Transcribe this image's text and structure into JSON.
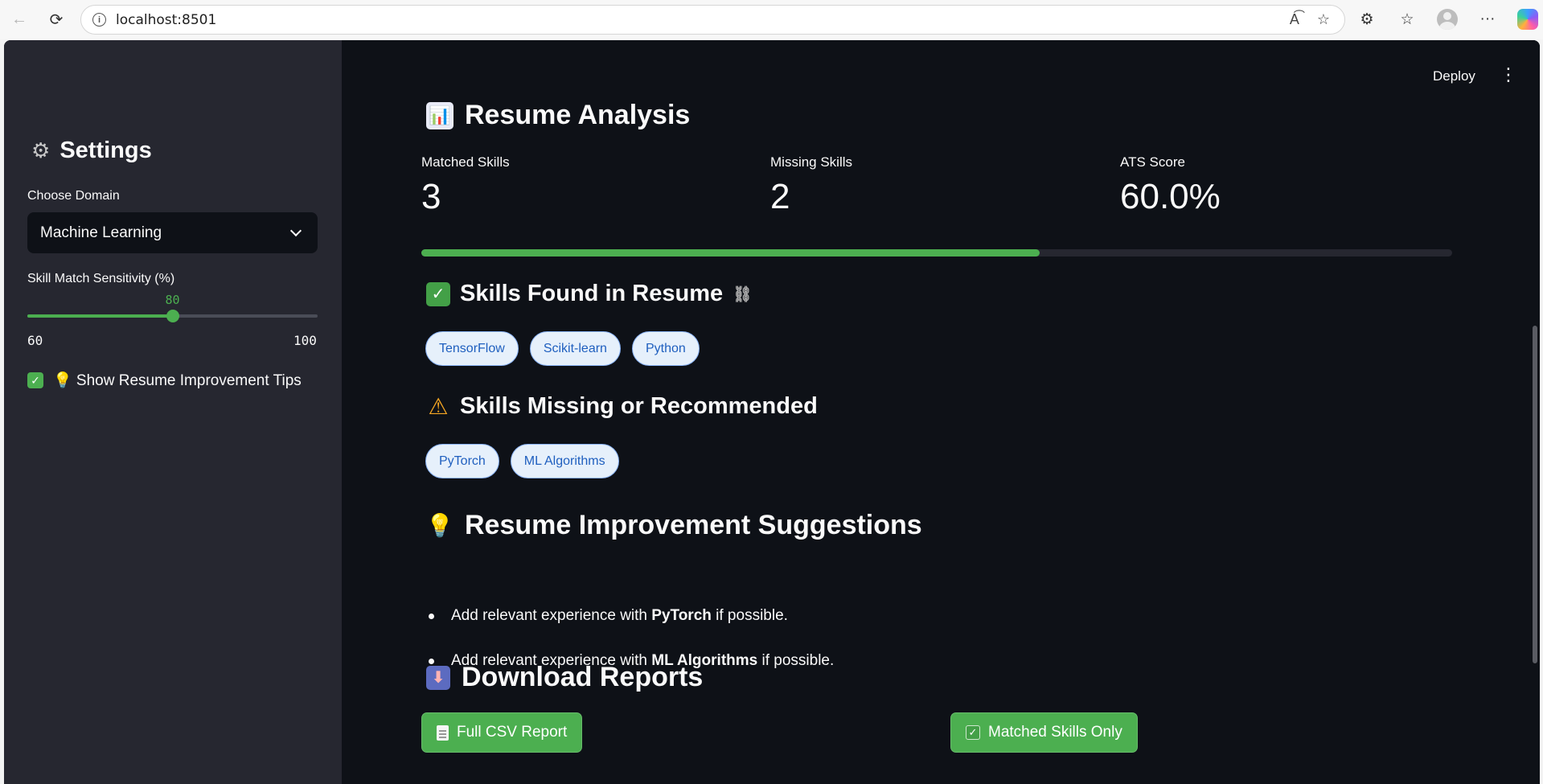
{
  "browser": {
    "url": "localhost:8501"
  },
  "header": {
    "deploy_label": "Deploy"
  },
  "sidebar": {
    "title": "Settings",
    "domain_label": "Choose Domain",
    "domain_value": "Machine Learning",
    "slider": {
      "label": "Skill Match Sensitivity (%)",
      "value": 80,
      "min": 60,
      "max": 100
    },
    "checkbox": {
      "label": "💡 Show Resume Improvement Tips",
      "checked": true
    }
  },
  "analysis": {
    "title": "Resume Analysis",
    "metrics": [
      {
        "label": "Matched Skills",
        "value": "3"
      },
      {
        "label": "Missing Skills",
        "value": "2"
      },
      {
        "label": "ATS Score",
        "value": "60.0%"
      }
    ],
    "progress": 0.6
  },
  "found": {
    "title": "Skills Found in Resume",
    "chips": [
      "TensorFlow",
      "Scikit-learn",
      "Python"
    ]
  },
  "missing": {
    "title": "Skills Missing or Recommended",
    "chips": [
      "PyTorch",
      "ML Algorithms"
    ]
  },
  "suggestions": {
    "title": "Resume Improvement Suggestions",
    "items": [
      {
        "prefix": "Add relevant experience with ",
        "skill": "PyTorch",
        "suffix": " if possible."
      },
      {
        "prefix": "Add relevant experience with ",
        "skill": "ML Algorithms",
        "suffix": " if possible."
      }
    ]
  },
  "downloads": {
    "title": "Download Reports",
    "full_csv_label": "Full CSV Report",
    "matched_only_label": "Matched Skills Only"
  },
  "colors": {
    "accent": "#4caf50",
    "background": "#0e1117",
    "sidebar": "#262730",
    "chip_bg": "#e6f0fb",
    "chip_text": "#1f5fbf"
  }
}
